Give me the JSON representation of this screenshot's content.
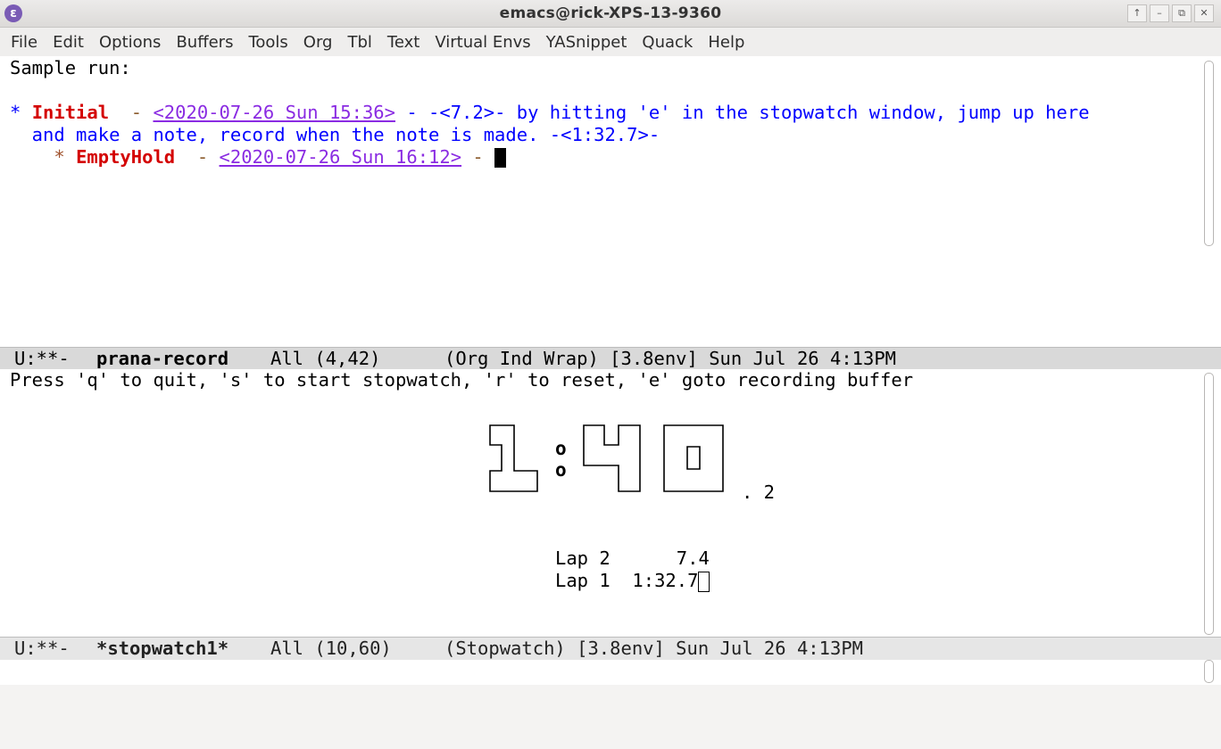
{
  "window": {
    "title": "emacs@rick-XPS-13-9360",
    "app_icon": "emacs-icon",
    "controls": [
      "↑",
      "–",
      "⧉",
      "✕"
    ]
  },
  "menu": [
    "File",
    "Edit",
    "Options",
    "Buffers",
    "Tools",
    "Org",
    "Tbl",
    "Text",
    "Virtual Envs",
    "YASnippet",
    "Quack",
    "Help"
  ],
  "record_buffer": {
    "line1": "Sample run:",
    "h1_star": "* ",
    "h1_title": "Initial",
    "h1_sep": "  - ",
    "h1_ts": "<2020-07-26 Sun 15:36>",
    "h1_text": " - -<7.2>- by hitting 'e' in the stopwatch window, jump up here",
    "h1_cont": "  and make a note, record when the note is made. -<1:32.7>-",
    "h2_star": "    * ",
    "h2_title": "EmptyHold",
    "h2_sep": "  - ",
    "h2_ts": "<2020-07-26 Sun 16:12>",
    "h2_end": " - "
  },
  "modeline_top": {
    "status": "U:**-",
    "buffer": "prana-record",
    "position": "All (4,42)",
    "modes": "(Org Ind Wrap) [3.8env] Sun Jul 26 4:13PM"
  },
  "stopwatch_buffer": {
    "help": "Press 'q' to quit, 's' to start stopwatch, 'r' to reset, 'e' goto recording buffer",
    "display_minutes": "1",
    "display_seconds": "40",
    "display_tenths": ". 2",
    "laps": [
      {
        "label": "Lap 2",
        "time": "   7.4"
      },
      {
        "label": "Lap 1",
        "time": "1:32.7"
      }
    ]
  },
  "modeline_bottom": {
    "status": "U:**-",
    "buffer": "*stopwatch1*",
    "position": "All (10,60)",
    "modes": "(Stopwatch) [3.8env] Sun Jul 26 4:13PM"
  }
}
